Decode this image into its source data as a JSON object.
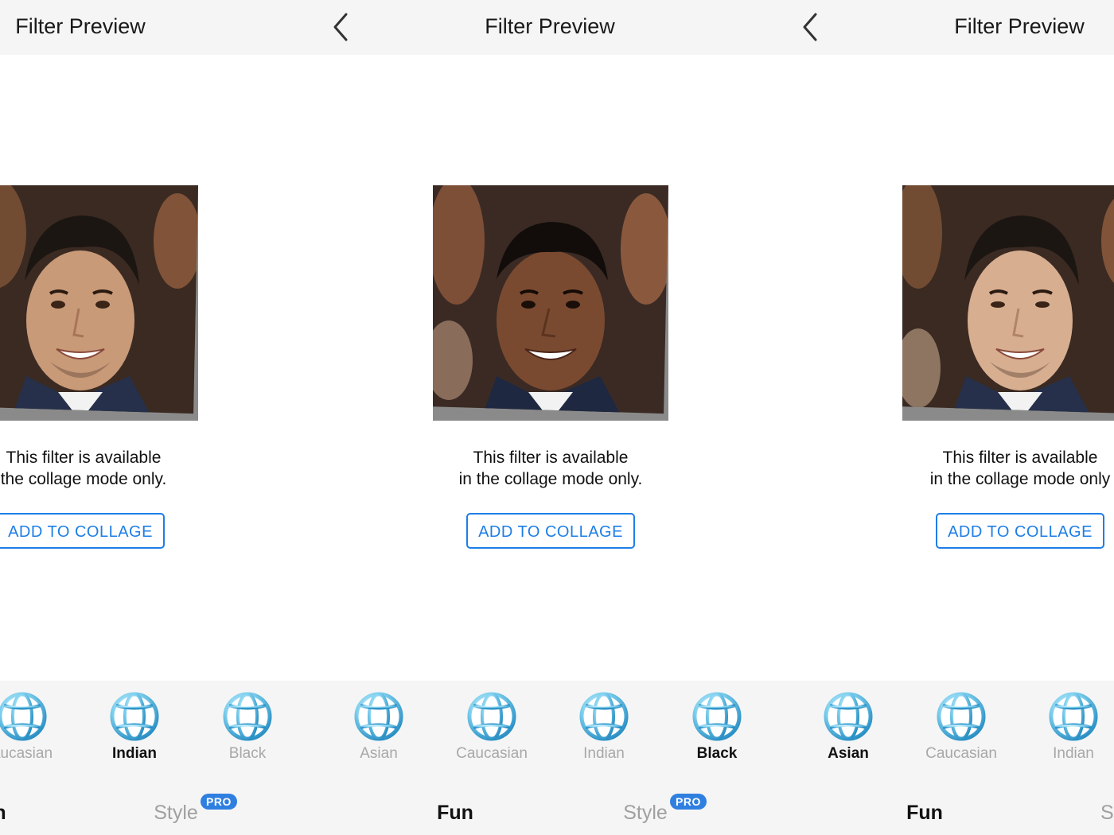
{
  "accent_color": "#1e7ee6",
  "panels": [
    {
      "title": "Filter Preview",
      "message_line1": "This filter is available",
      "message_line2": "the collage mode only.",
      "button": "ADD TO COLLAGE",
      "filters": [
        {
          "label": "aucasian",
          "icon": "globe-icon",
          "active": false
        },
        {
          "label": "Indian",
          "icon": "globe-icon",
          "active": true
        },
        {
          "label": "Black",
          "icon": "globe-icon",
          "active": false
        }
      ],
      "categories": [
        {
          "label": "n",
          "active": true
        },
        {
          "label": "Style",
          "active": false,
          "badge": "PRO"
        }
      ]
    },
    {
      "title": "Filter Preview",
      "message_line1": "This filter is available",
      "message_line2": "in the collage mode only.",
      "button": "ADD TO COLLAGE",
      "filters": [
        {
          "label": "Asian",
          "icon": "globe-icon",
          "active": false
        },
        {
          "label": "Caucasian",
          "icon": "globe-icon",
          "active": false
        },
        {
          "label": "Indian",
          "icon": "globe-icon",
          "active": false
        },
        {
          "label": "Black",
          "icon": "globe-icon",
          "active": true
        }
      ],
      "categories": [
        {
          "label": "Fun",
          "active": true
        },
        {
          "label": "Style",
          "active": false,
          "badge": "PRO"
        }
      ]
    },
    {
      "title": "Filter Preview",
      "message_line1": "This filter is available",
      "message_line2": "in the collage mode only",
      "button": "ADD TO COLLAGE",
      "filters": [
        {
          "label": "Asian",
          "icon": "globe-icon",
          "active": true
        },
        {
          "label": "Caucasian",
          "icon": "globe-icon",
          "active": false
        },
        {
          "label": "Indian",
          "icon": "globe-icon",
          "active": false
        }
      ],
      "categories": [
        {
          "label": "Fun",
          "active": true
        },
        {
          "label": "Sty",
          "active": false
        }
      ]
    }
  ]
}
